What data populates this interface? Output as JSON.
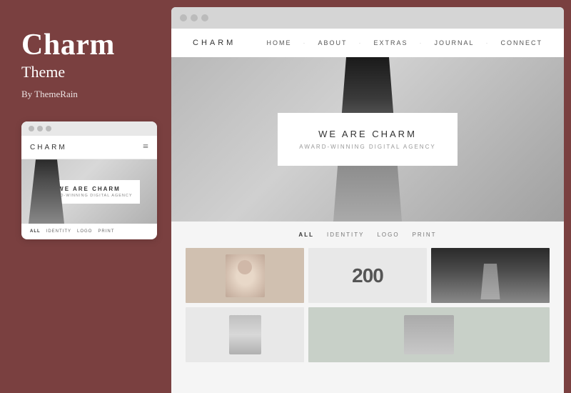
{
  "sidebar": {
    "title": "Charm",
    "subtitle": "Theme",
    "by": "By ThemeRain"
  },
  "mobile_preview": {
    "logo": "CHARM",
    "hamburger": "≡",
    "hero": {
      "headline": "WE ARE CHARM",
      "subheadline": "AWARD-WINNING DIGITAL AGENCY"
    },
    "filters": [
      "ALL",
      "IDENTITY",
      "LOGO",
      "PRINT"
    ]
  },
  "desktop": {
    "logo": "CHARM",
    "nav_links": [
      "HOME",
      "ABOUT",
      "EXTRAS",
      "JOURNAL",
      "CONNECT"
    ],
    "hero": {
      "headline": "WE ARE CHARM",
      "subheadline": "AWARD-WINNING DIGITAL AGENCY"
    },
    "portfolio_filters": [
      "ALL",
      "IDENTITY",
      "LOGO",
      "PRINT"
    ],
    "grid_item_number": "200"
  },
  "colors": {
    "sidebar_bg": "#7a4040",
    "sidebar_text": "#ffffff"
  }
}
